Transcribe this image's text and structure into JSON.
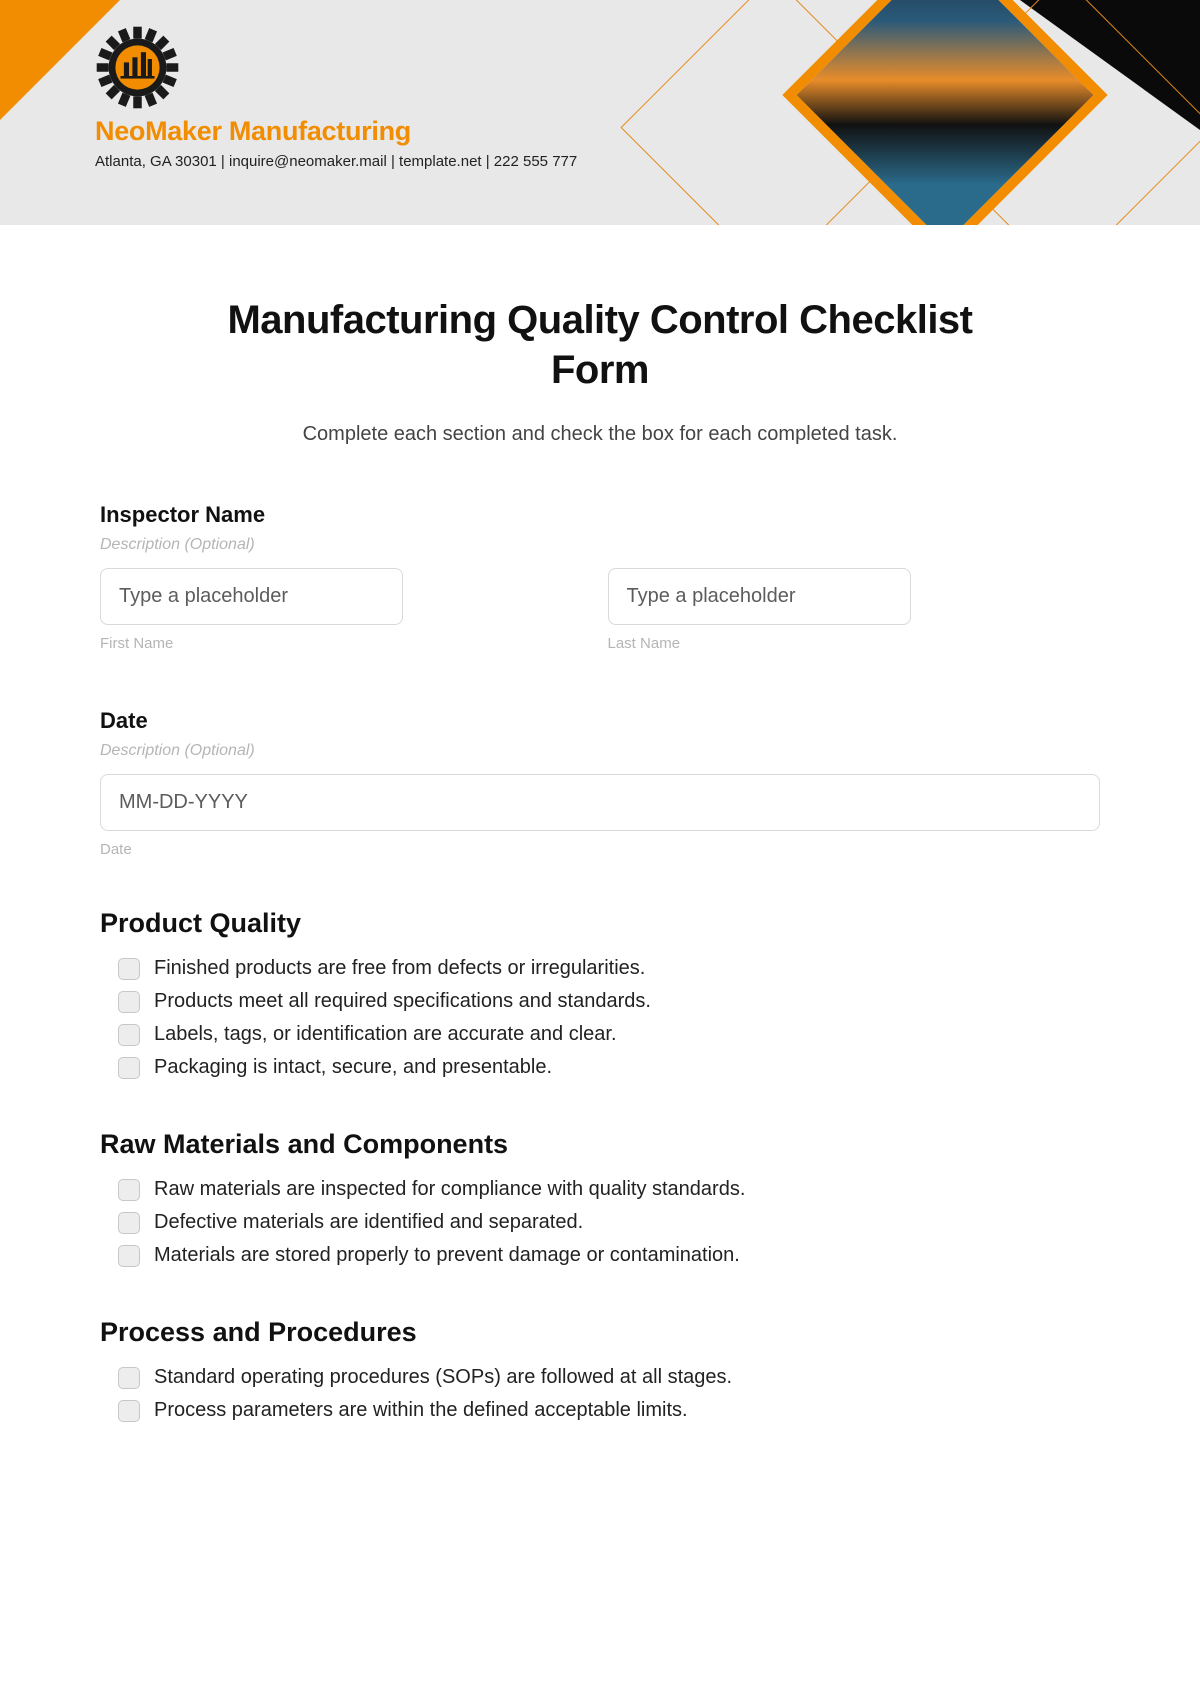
{
  "header": {
    "company_name": "NeoMaker Manufacturing",
    "company_sub": "Atlanta, GA 30301 | inquire@neomaker.mail | template.net | 222 555 777"
  },
  "form": {
    "title": "Manufacturing Quality Control Checklist Form",
    "subtitle": "Complete each section and check the box for each completed task."
  },
  "inspector": {
    "label": "Inspector Name",
    "desc": "Description (Optional)",
    "first_ph": "Type a placeholder",
    "last_ph": "Type a placeholder",
    "first_sub": "First Name",
    "last_sub": "Last Name"
  },
  "date": {
    "label": "Date",
    "desc": "Description (Optional)",
    "ph": "MM-DD-YYYY",
    "sub": "Date"
  },
  "sections": {
    "product_quality": {
      "title": "Product Quality",
      "items": [
        "Finished products are free from defects or irregularities.",
        "Products meet all required specifications and standards.",
        "Labels, tags, or identification are accurate and clear.",
        "Packaging is intact, secure, and presentable."
      ]
    },
    "raw_materials": {
      "title": "Raw Materials and Components",
      "items": [
        "Raw materials are inspected for compliance with quality standards.",
        "Defective materials are identified and separated.",
        "Materials are stored properly to prevent damage or contamination."
      ]
    },
    "process": {
      "title": "Process and Procedures",
      "items": [
        "Standard operating procedures (SOPs) are followed at all stages.",
        "Process parameters are within the defined acceptable limits."
      ]
    }
  }
}
